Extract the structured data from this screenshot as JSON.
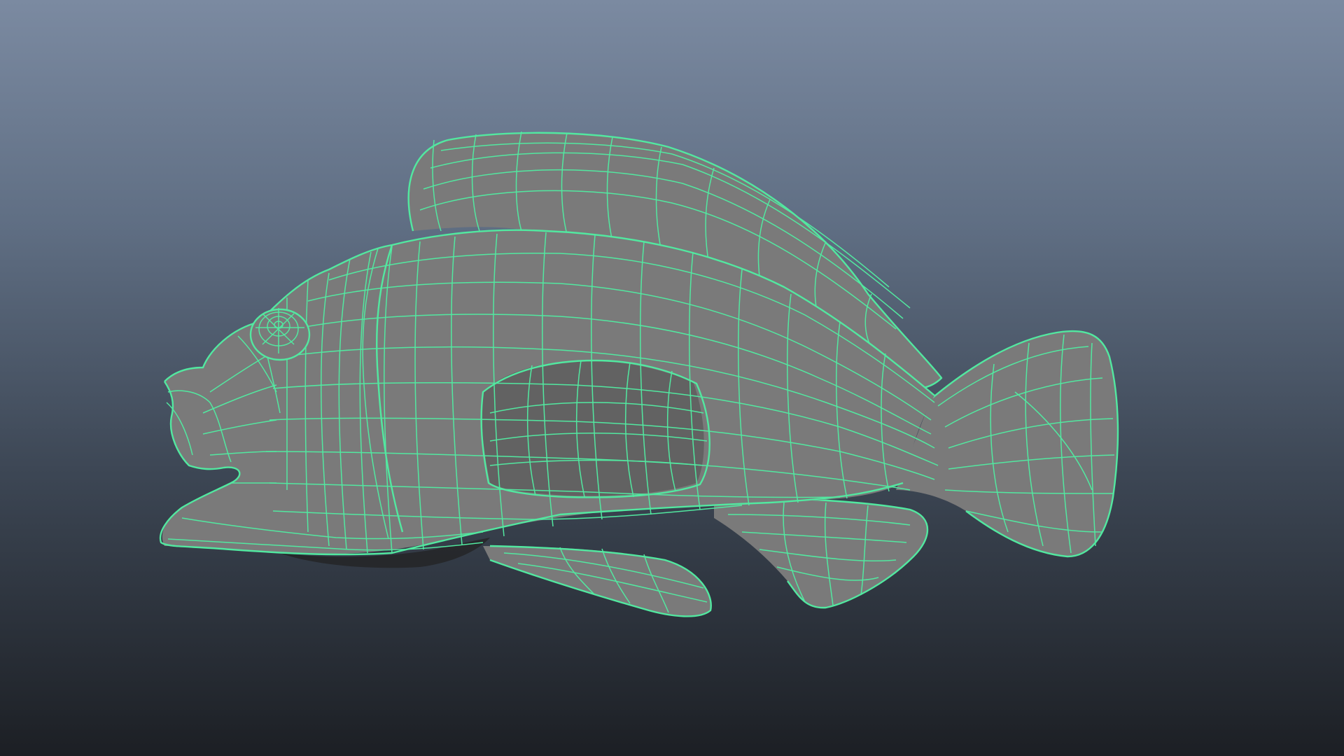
{
  "viewport": {
    "background_top": "#7b8aa1",
    "background_bottom": "#1c1f24",
    "mesh_fill": "#7a7a7a",
    "wireframe_color": "#52e8a0",
    "display_mode": "wireframe-on-shaded"
  },
  "object": {
    "icon": "fish-mesh"
  }
}
